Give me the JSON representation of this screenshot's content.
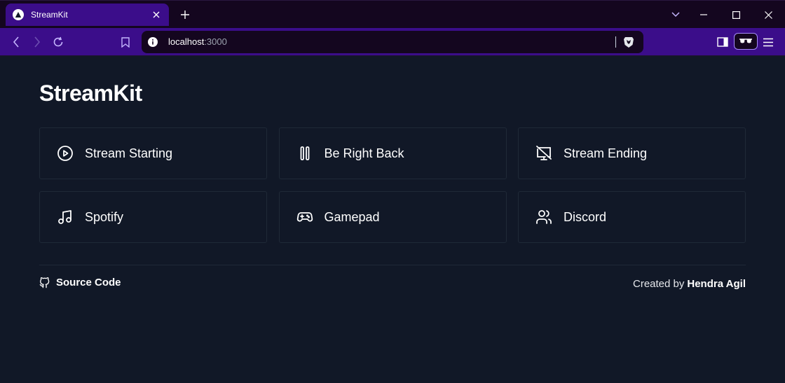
{
  "browser": {
    "tab_title": "StreamKit",
    "url_host": "localhost",
    "url_port": ":3000"
  },
  "page": {
    "title": "StreamKit",
    "cards": [
      {
        "label": "Stream Starting",
        "icon": "play-circle-icon"
      },
      {
        "label": "Be Right Back",
        "icon": "pause-icon"
      },
      {
        "label": "Stream Ending",
        "icon": "screen-off-icon"
      },
      {
        "label": "Spotify",
        "icon": "music-note-icon"
      },
      {
        "label": "Gamepad",
        "icon": "gamepad-icon"
      },
      {
        "label": "Discord",
        "icon": "users-icon"
      }
    ],
    "footer": {
      "source_label": "Source Code",
      "created_prefix": "Created by",
      "author": "Hendra Agil"
    }
  },
  "colors": {
    "page_background": "#111827",
    "card_border": "#1f2937",
    "browser_accent": "#3b0d8a",
    "browser_dark": "#14061f"
  }
}
